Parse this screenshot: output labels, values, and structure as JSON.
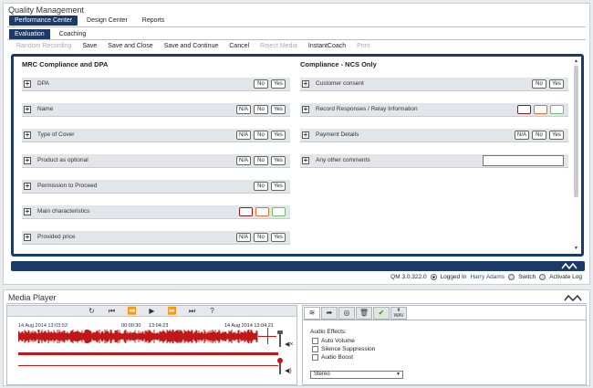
{
  "app": {
    "title": "Quality Management"
  },
  "nav": {
    "tabs": [
      "Performance Center",
      "Design Center",
      "Reports"
    ]
  },
  "subnav": {
    "tabs": [
      "Evaluation",
      "Coaching"
    ]
  },
  "toolbar": {
    "items": [
      {
        "label": "Random Recording",
        "enabled": false
      },
      {
        "label": "Save",
        "enabled": true
      },
      {
        "label": "Save and Close",
        "enabled": true
      },
      {
        "label": "Save and Continue",
        "enabled": true
      },
      {
        "label": "Cancel",
        "enabled": true
      },
      {
        "label": "Reject Media",
        "enabled": false
      },
      {
        "label": "InstantCoach",
        "enabled": true
      },
      {
        "label": "Print",
        "enabled": false
      }
    ]
  },
  "form": {
    "left": {
      "title": "MRC Compliance and DPA",
      "rows": [
        {
          "label": "DPA",
          "buttons": [
            "No",
            "Yes"
          ]
        },
        {
          "label": "Name",
          "buttons": [
            "N/A",
            "No",
            "Yes"
          ]
        },
        {
          "label": "Type of Cover",
          "buttons": [
            "N/A",
            "No",
            "Yes"
          ]
        },
        {
          "label": "Product as optional",
          "buttons": [
            "N/A",
            "No",
            "Yes"
          ]
        },
        {
          "label": "Permission to Proceed",
          "buttons": [
            "No",
            "Yes"
          ]
        },
        {
          "label": "Main characteristics",
          "buttons": []
        },
        {
          "label": "Provided price",
          "buttons": [
            "N/A",
            "No",
            "Yes"
          ]
        }
      ]
    },
    "right": {
      "title": "Compliance - NCS Only",
      "rows": [
        {
          "label": "Customer consent",
          "buttons": [
            "No",
            "Yes"
          ]
        },
        {
          "label": "Record Responses / Relay Information",
          "buttons": []
        },
        {
          "label": "Payment Details",
          "buttons": [
            "N/A",
            "No",
            "Yes"
          ]
        },
        {
          "label": "Any other comments",
          "buttons": []
        }
      ]
    }
  },
  "status": {
    "version": "QM 3.0.322.0",
    "logged_in": "Logged In",
    "user": "Harry Adams",
    "switch": "Switch",
    "activate_log": "Activate Log"
  },
  "media_player": {
    "title": "Media Player",
    "timeline": {
      "start": "14 Aug 2014 13:03:53",
      "offset": "00:00:30",
      "mid": "13:04:23",
      "end": "14 Aug 2014 13:04:21"
    },
    "effects": {
      "heading": "Audio Effects:",
      "options": [
        "Auto Volume",
        "Silence Suppression",
        "Audio Boost"
      ],
      "channel_mode": "Stereo"
    },
    "tabs": [
      "wave-tab",
      "share-tab",
      "search-tab",
      "delete-tab",
      "approve-tab",
      "wav-tab"
    ],
    "wav_label": "WAV"
  },
  "colors": {
    "accent": "#1c3a66",
    "waveform": "#c01818",
    "red_outline": "#8b1a1a",
    "orange_outline": "#e07030",
    "green_outline": "#6cc070"
  }
}
